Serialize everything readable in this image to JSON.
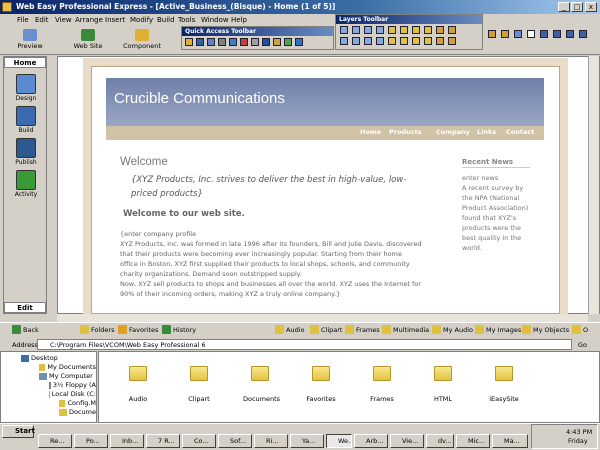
{
  "window": {
    "title": "Web Easy Professional Express - [Active_Business_(Bisque) - Home (1 of 5)]",
    "min": "_",
    "max": "□",
    "close": "x"
  },
  "menu": [
    "File",
    "Edit",
    "View",
    "Arrange",
    "Insert",
    "Modify",
    "Build",
    "Tools",
    "Window",
    "Help"
  ],
  "toolbar": {
    "preview": "Preview",
    "website": "Web Site",
    "component": "Component"
  },
  "quick_access": {
    "title": "Quick Access Toolbar"
  },
  "layers_toolbar": {
    "title": "Layers Toolbar"
  },
  "left_panel": {
    "tab": "Home",
    "items": [
      "Design",
      "Build",
      "Publish",
      "Activity"
    ],
    "bottom_tab": "Edit"
  },
  "site": {
    "title": "Crucible Communications",
    "nav": [
      "Home",
      "Products",
      "Company",
      "Links",
      "Contact"
    ],
    "welcome": "Welcome",
    "slogan": "{XYZ Products, Inc. strives to deliver the best in high-value, low-priced products}",
    "welcome_sub": "Welcome to our web site.",
    "body_lines": [
      "{enter company profile",
      "XYZ Products, Inc. was formed in late 1996 after its founders, Bill and Julie Davis, discovered",
      "that their products were becoming ever increasingly popular.  Starting from their home",
      "office in Boston, XYZ first supplied their products to local shops, schools, and community",
      "charity organizations.  Demand soon outstripped supply.",
      "Now, XYZ sell products to shops and businesses all over the world. XYZ uses the Internet for",
      "90% of their incoming orders, making XYZ a truly online company.}"
    ],
    "recent_news_title": "Recent News",
    "recent_news": [
      "enter news",
      "A recent survey by",
      "the NPA (National",
      "Product Association)",
      "found that XYZ's",
      "products were the",
      "best quality in the",
      "world."
    ]
  },
  "explorer": {
    "toolbar": [
      "Back",
      "Folders",
      "Favorites",
      "History",
      "Audio",
      "Clipart",
      "Frames",
      "Multimedia",
      "My Audio",
      "My Images",
      "My Objects",
      "O"
    ],
    "address_label": "Address",
    "address": "C:\\Program Files\\VCOM\\Web Easy Professional 6",
    "go": "Go",
    "tree": [
      "Desktop",
      "My Documents",
      "My Computer",
      "3½ Floppy (A",
      "Local Disk (C:",
      "Config.M",
      "Docume"
    ],
    "folders": [
      "Audio",
      "Clipart",
      "Documents",
      "Favorites",
      "Frames",
      "HTML",
      "iEasySite"
    ]
  },
  "taskbar": {
    "start": "Start",
    "tasks": [
      "Re...",
      "Po...",
      "Inb...",
      "7 R...",
      "Co...",
      "Sof...",
      "Ri...",
      "Ya...",
      "We...",
      "Arb...",
      "Vie...",
      "dv...",
      "Mic...",
      "Ma..."
    ],
    "time": "4:43 PM",
    "day": "Friday"
  }
}
